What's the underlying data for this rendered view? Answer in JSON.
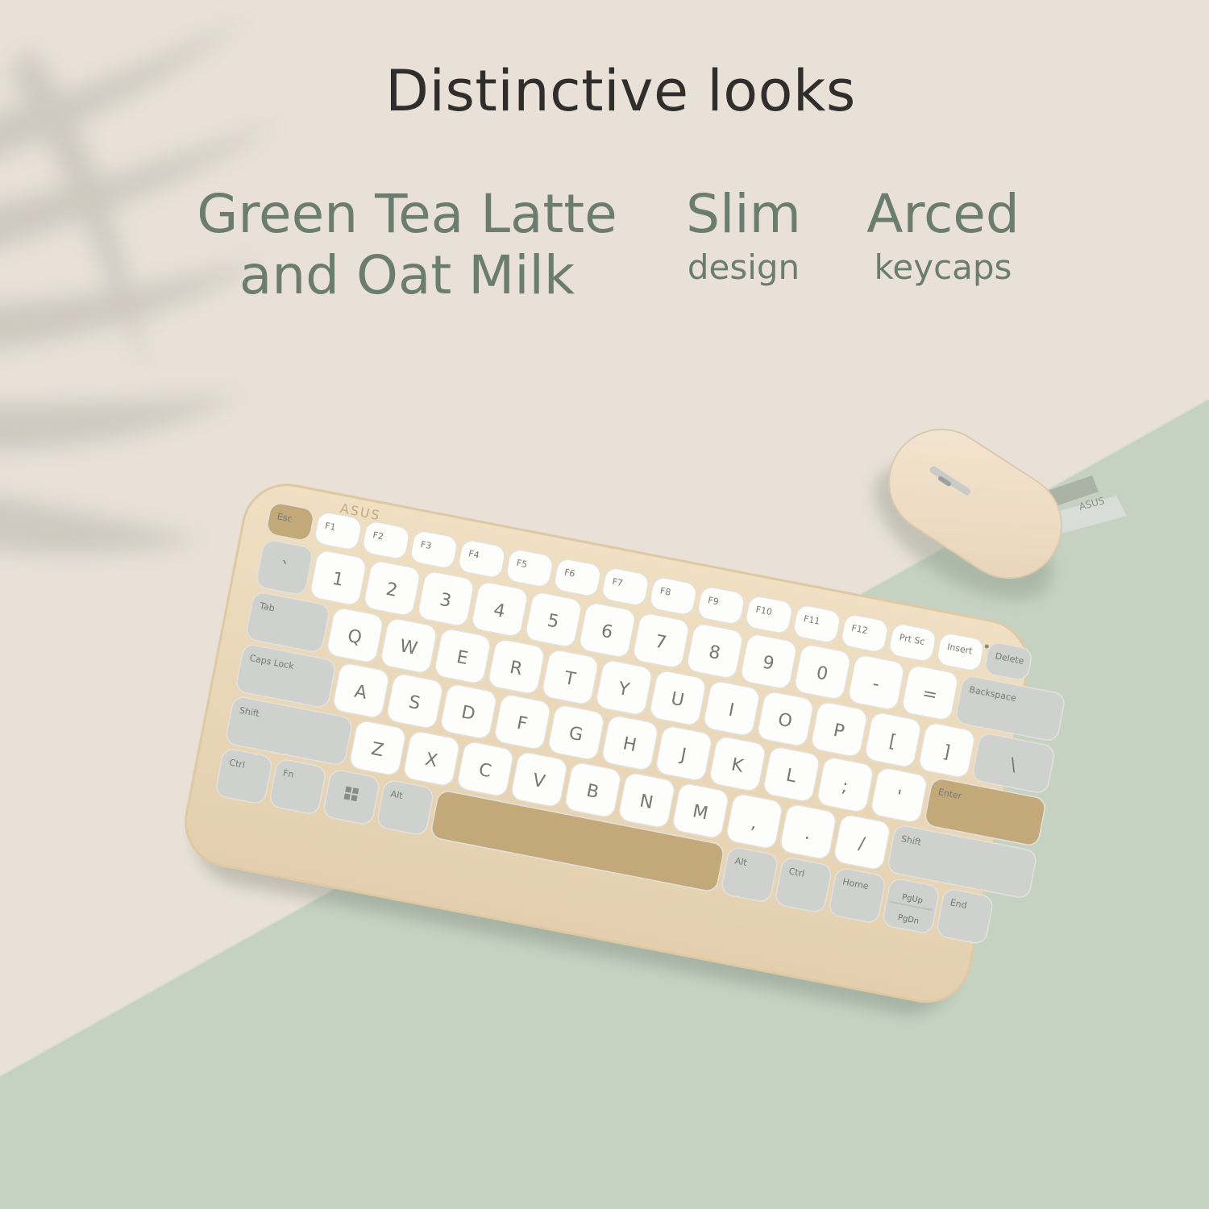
{
  "headline": "Distinctive looks",
  "features": [
    {
      "line1": "Green Tea Latte",
      "line2": "and Oat Milk"
    },
    {
      "line1": "Slim",
      "line2": "design"
    },
    {
      "line1": "Arced",
      "line2": "keycaps"
    }
  ],
  "brand": "ASUS",
  "colors": {
    "background_top": "#e9e1d8",
    "background_bottom": "#c4d1c1",
    "body": "#ead7b9",
    "keycap_white": "#fdfdfc",
    "keycap_gray": "#cfd1cf",
    "keycap_accent": "#c3a87a",
    "text_green": "#6b7d6e",
    "text_dark": "#2f2e2c"
  },
  "keyboard": {
    "fn_row": [
      "Esc",
      "F1",
      "F2",
      "F3",
      "F4",
      "F5",
      "F6",
      "F7",
      "F8",
      "F9",
      "F10",
      "F11",
      "F12",
      "Prt Sc",
      "Insert",
      "Delete"
    ],
    "number_row": [
      "`",
      "1",
      "2",
      "3",
      "4",
      "5",
      "6",
      "7",
      "8",
      "9",
      "0",
      "-",
      "=",
      "Backspace"
    ],
    "top_row": [
      "Tab",
      "Q",
      "W",
      "E",
      "R",
      "T",
      "Y",
      "U",
      "I",
      "O",
      "P",
      "[",
      "]",
      "\\"
    ],
    "home_row": [
      "Caps Lock",
      "A",
      "S",
      "D",
      "F",
      "G",
      "H",
      "J",
      "K",
      "L",
      ";",
      "'",
      "Enter"
    ],
    "bottom_row": [
      "Shift",
      "Z",
      "X",
      "C",
      "V",
      "B",
      "N",
      "M",
      ",",
      ".",
      "/",
      "Shift"
    ],
    "space_row": [
      "Ctrl",
      "Fn",
      "",
      "Alt",
      "",
      "Alt",
      "Ctrl",
      "Home",
      "PgUp",
      "PgDn",
      "End"
    ]
  }
}
